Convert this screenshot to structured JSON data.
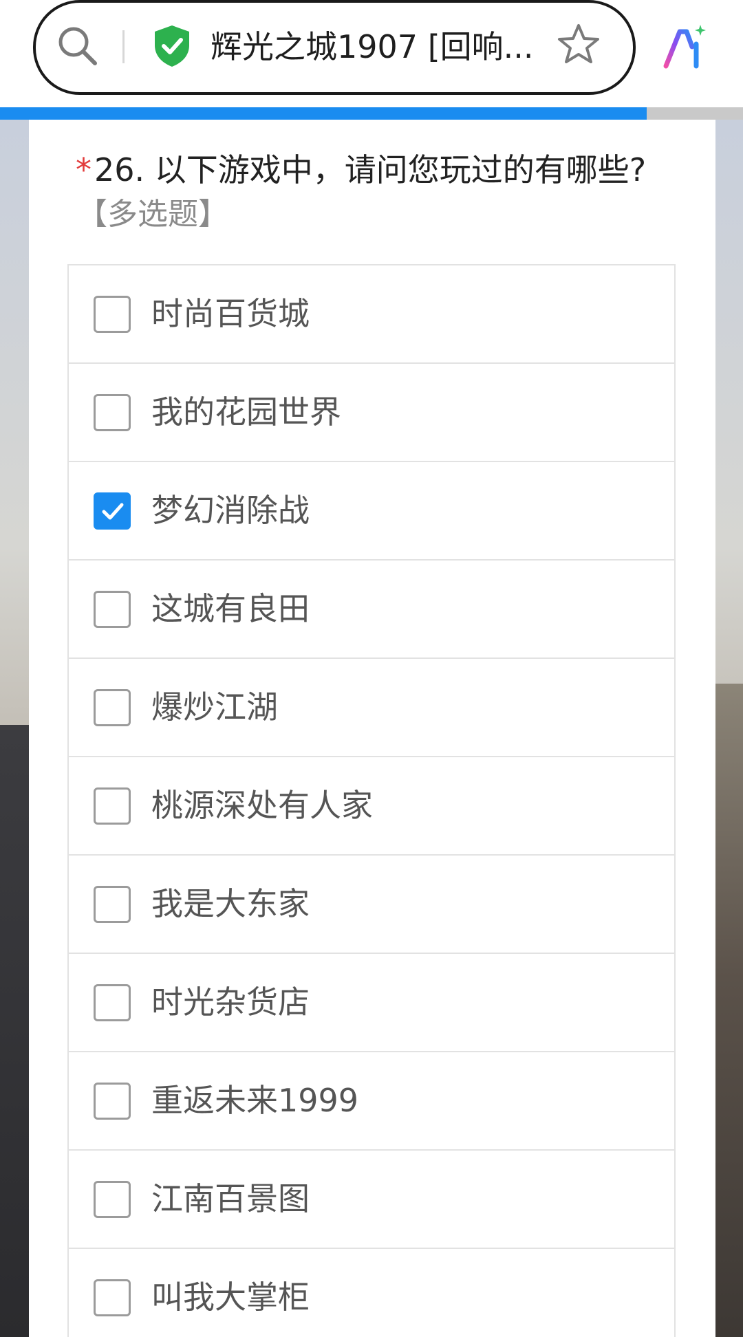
{
  "browser": {
    "page_title": "辉光之城1907 [回响...",
    "load_progress": 0.87,
    "accent_color": "#1a8cf0",
    "icons": [
      "search-icon",
      "shield-check-icon",
      "star-icon",
      "ai-assistant-icon"
    ]
  },
  "survey": {
    "required_mark": "*",
    "question": "26. 以下游戏中，请问您玩过的有哪些?",
    "question_type": "【多选题】",
    "options": [
      {
        "label": "时尚百货城",
        "checked": false
      },
      {
        "label": "我的花园世界",
        "checked": false
      },
      {
        "label": "梦幻消除战",
        "checked": true
      },
      {
        "label": "这城有良田",
        "checked": false
      },
      {
        "label": "爆炒江湖",
        "checked": false
      },
      {
        "label": "桃源深处有人家",
        "checked": false
      },
      {
        "label": "我是大东家",
        "checked": false
      },
      {
        "label": "时光杂货店",
        "checked": false
      },
      {
        "label": "重返未来1999",
        "checked": false
      },
      {
        "label": "江南百景图",
        "checked": false
      },
      {
        "label": "叫我大掌柜",
        "checked": false
      }
    ]
  }
}
